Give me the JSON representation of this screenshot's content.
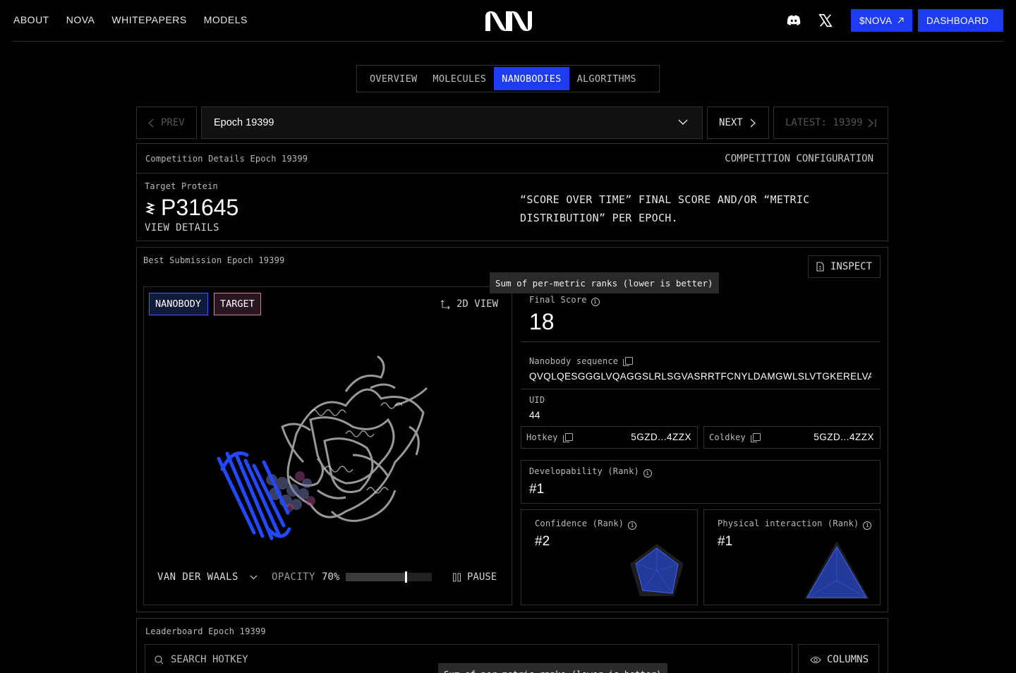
{
  "nav": {
    "links": [
      "ABOUT",
      "NOVA",
      "WHITEPAPERS",
      "MODELS"
    ],
    "nova_button": "$NOVA",
    "dashboard_button": "DASHBOARD"
  },
  "tabs": [
    {
      "label": "OVERVIEW",
      "active": false
    },
    {
      "label": "MOLECULES",
      "active": false
    },
    {
      "label": "NANOBODIES",
      "active": true
    },
    {
      "label": "ALGORITHMS",
      "active": false
    }
  ],
  "epoch_nav": {
    "prev": "PREV",
    "selected": "Epoch 19399",
    "next": "NEXT",
    "latest": "LATEST: 19399"
  },
  "competition": {
    "title": "Competition Details Epoch 19399",
    "config_label": "COMPETITION CONFIGURATION",
    "target_label": "Target Protein",
    "target_id": "P31645",
    "view_details": "VIEW DETAILS",
    "note_line1": "“SCORE OVER TIME” FINAL SCORE AND/OR “METRIC",
    "note_line2": "DISTRIBUTION” PER EPOCH."
  },
  "best_submission": {
    "title": "Best Submission Epoch 19399",
    "inspect": "INSPECT",
    "legend_nanobody": "NANOBODY",
    "legend_target": "TARGET",
    "view_toggle": "2D VIEW",
    "render_mode": "VAN DER WAALS",
    "opacity_label": "OPACITY",
    "opacity_value": "70%",
    "opacity_fraction": 0.7,
    "pause": "PAUSE",
    "tooltip": "Sum of per-metric ranks (lower is better)",
    "final_score_label": "Final Score",
    "final_score": "18",
    "sequence_label": "Nanobody sequence",
    "sequence": "QVQLQESGGGLVQAGGSLRLSGVASRRTFCNYLDAMGWLSLVTGKERELVAHITGN…",
    "uid_label": "UID",
    "uid": "44",
    "hotkey_label": "Hotkey",
    "hotkey": "5GZD...4ZZX",
    "coldkey_label": "Coldkey",
    "coldkey": "5GZD...4ZZX",
    "developability_label": "Developability (Rank)",
    "developability": "#1",
    "confidence_label": "Confidence (Rank)",
    "confidence": "#2",
    "physical_label": "Physical interaction (Rank)",
    "physical": "#1"
  },
  "leaderboard": {
    "title": "Leaderboard Epoch 19399",
    "search_placeholder": "SEARCH HOTKEY",
    "columns": "COLUMNS",
    "tooltip_partial": "Sum of per-metric ranks (lower is better)"
  },
  "colors": {
    "accent": "#1d3cf0",
    "nanobody": "#2a4bff",
    "target": "#b0b0b0"
  }
}
